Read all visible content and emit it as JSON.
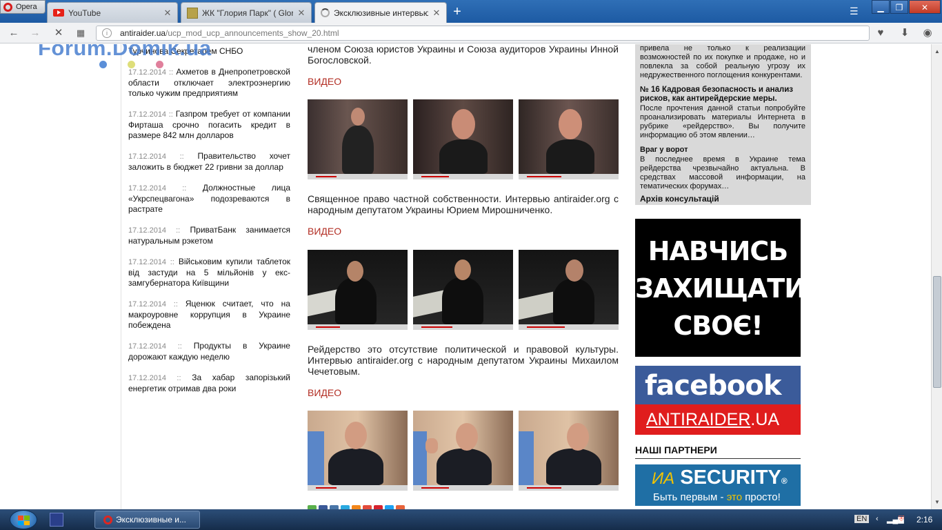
{
  "browser": {
    "menu_label": "Opera",
    "tabs": [
      {
        "title": "YouTube",
        "close": "✕"
      },
      {
        "title": "ЖК \"Глория Парк\" ( Gloria P",
        "close": "✕"
      },
      {
        "title": "Эксклюзивные интервью",
        "close": "✕"
      }
    ],
    "new_tab": "+",
    "window_controls": {
      "minimize": "▁",
      "maximize": "❐",
      "close": "✕"
    },
    "url_host": "antiraider.ua",
    "url_path": "/ucp_mod_ucp_announcements_show_20.html"
  },
  "watermark": "Forum.Domik.ua",
  "news": [
    {
      "date": "",
      "text": "Турчинова Секретарем СНБО"
    },
    {
      "date": "17.12.2014 ::",
      "text": "Ахметов в Днепропетровской области отключает электроэнергию только чужим предприятиям"
    },
    {
      "date": "17.12.2014 ::",
      "text": "Газпром требует от компании Фирташа срочно погасить кредит в размере 842 млн долларов"
    },
    {
      "date": "17.12.2014 ::",
      "text": "Правительство хочет заложить в бюджет 22 гривни за доллар"
    },
    {
      "date": "17.12.2014 ::",
      "text": "Должностные лица «Укрспецвагона» подозреваются в растрате"
    },
    {
      "date": "17.12.2014 ::",
      "text": "ПриватБанк занимается натуральным рэкетом"
    },
    {
      "date": "17.12.2014 ::",
      "text": "Військовим купили таблеток від застуди на 5 мільйонів у екс-замгубернатора Київщини"
    },
    {
      "date": "17.12.2014 ::",
      "text": "Яценюк считает, что на макроуровне коррупция в Украине побеждена"
    },
    {
      "date": "17.12.2014 ::",
      "text": "Продукты в Украине дорожают каждую неделю"
    },
    {
      "date": "17.12.2014 ::",
      "text": "За хабар запорізький енергетик отримав два роки"
    }
  ],
  "main": {
    "intro": "членом Союза юристов Украины и Союза аудиторов Украины Инной Богословской.",
    "video_label": "ВИДЕО",
    "interview2": "Священное право частной собственности. Интервью antiraider.org с народным депутатом Украины Юрием Мирошниченко.",
    "interview3": "Рейдерство это отсутствие политической и правовой культуры. Интервью antiraider.org с народным депутатом Украины Михаилом Чечетовым."
  },
  "sidebar": {
    "top_text": "привела не только к реализации возможностей по их покупке и продаже, но и повлекла за собой реальную угрозу их недружественного поглощения конкурентами.",
    "item1_title": "№ 16 Кадровая безопасность и анализ рисков, как антирейдерские меры.",
    "item1_text": "После прочтения данной статьи попробуйте проанализировать материалы Интернета в рубрике «рейдерство». Вы получите информацию об этом явлении…",
    "item2_title": "Враг у ворот",
    "item2_text": "В последнее время в Украине тема рейдерства чрезвычайно актуальна. В средствах массовой информации, на тематических форумах…",
    "archive": "Архів консультацій",
    "banner_line1": "НАВЧИСЬ",
    "banner_line2": "ЗАХИЩАТИ",
    "banner_line3": "СВОЄ!",
    "fb_title": "facebook",
    "fb_site_main": "ANTIRAIDER",
    "fb_site_tld": ".UA",
    "partners": "НАШІ ПАРТНЕРИ",
    "security_ia": "ИА",
    "security_name": "SECURITY",
    "security_reg": "®",
    "security_slogan_a": "Быть первым - ",
    "security_slogan_b": "это",
    "security_slogan_c": " просто!"
  },
  "taskbar": {
    "active_window": "Эксклюзивные и...",
    "lang": "EN",
    "clock": "2:16"
  }
}
